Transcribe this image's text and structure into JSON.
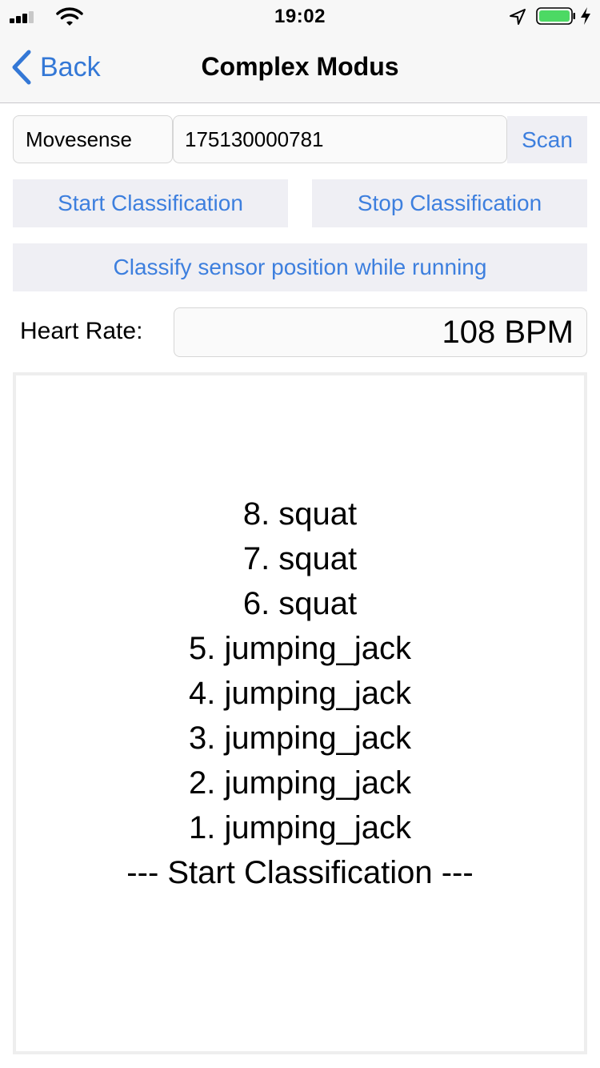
{
  "status_bar": {
    "time": "19:02",
    "icons": [
      "signal-icon",
      "wifi-icon",
      "location-icon",
      "battery-icon",
      "charging-icon"
    ]
  },
  "nav": {
    "back_label": "Back",
    "title": "Complex Modus"
  },
  "device": {
    "name": "Movesense",
    "serial": "175130000781",
    "scan_label": "Scan"
  },
  "actions": {
    "start_label": "Start Classification",
    "stop_label": "Stop Classification",
    "position_label": "Classify sensor position while running"
  },
  "heart_rate": {
    "label": "Heart Rate:",
    "value": "108 BPM"
  },
  "log": {
    "lines": [
      "8. squat",
      "7. squat",
      "6. squat",
      "5. jumping_jack",
      "4. jumping_jack",
      "3. jumping_jack",
      "2. jumping_jack",
      "1. jumping_jack",
      "--- Start Classification ---"
    ]
  },
  "colors": {
    "accent": "#3478d6",
    "button_bg": "#efeff4",
    "battery": "#4cd964"
  }
}
